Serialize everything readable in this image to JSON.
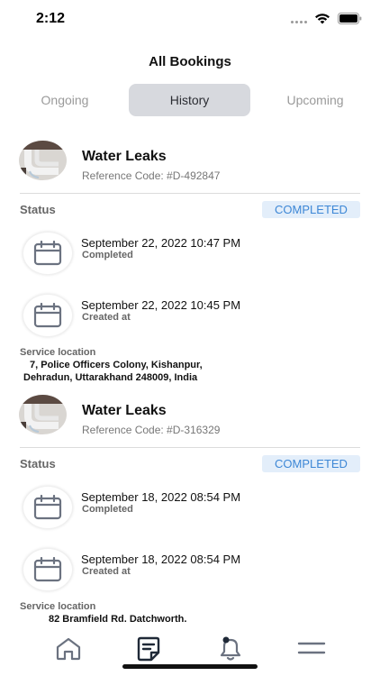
{
  "status_bar": {
    "time": "2:12"
  },
  "header": {
    "title": "All Bookings"
  },
  "tabs": [
    {
      "label": "Ongoing",
      "active": false
    },
    {
      "label": "History",
      "active": true
    },
    {
      "label": "Upcoming",
      "active": false
    }
  ],
  "bookings": [
    {
      "title": "Water Leaks",
      "reference": "Reference Code: #D-492847",
      "status_label": "Status",
      "status": "COMPLETED",
      "events": [
        {
          "date": "September 22, 2022 10:47 PM",
          "label": "Completed"
        },
        {
          "date": "September 22, 2022 10:45 PM",
          "label": "Created at"
        }
      ],
      "location_label": "Service location",
      "location_line1": "7, Police Officers Colony, Kishanpur,",
      "location_line2": "Dehradun, Uttarakhand 248009, India"
    },
    {
      "title": "Water Leaks",
      "reference": "Reference Code: #D-316329",
      "status_label": "Status",
      "status": "COMPLETED",
      "events": [
        {
          "date": "September 18, 2022 08:54 PM",
          "label": "Completed"
        },
        {
          "date": "September 18, 2022 08:54 PM",
          "label": "Created at"
        }
      ],
      "location_label": "Service location",
      "location_line1": "82 Bramfield Rd, Datchworth,",
      "location_line2": ""
    }
  ],
  "nav": [
    "home-icon",
    "bookings-icon",
    "notifications-icon",
    "menu-icon"
  ],
  "colors": {
    "badge_text": "#3d87d6",
    "badge_bg": "#e3eefa",
    "active_tab_bg": "#d7d9de"
  }
}
